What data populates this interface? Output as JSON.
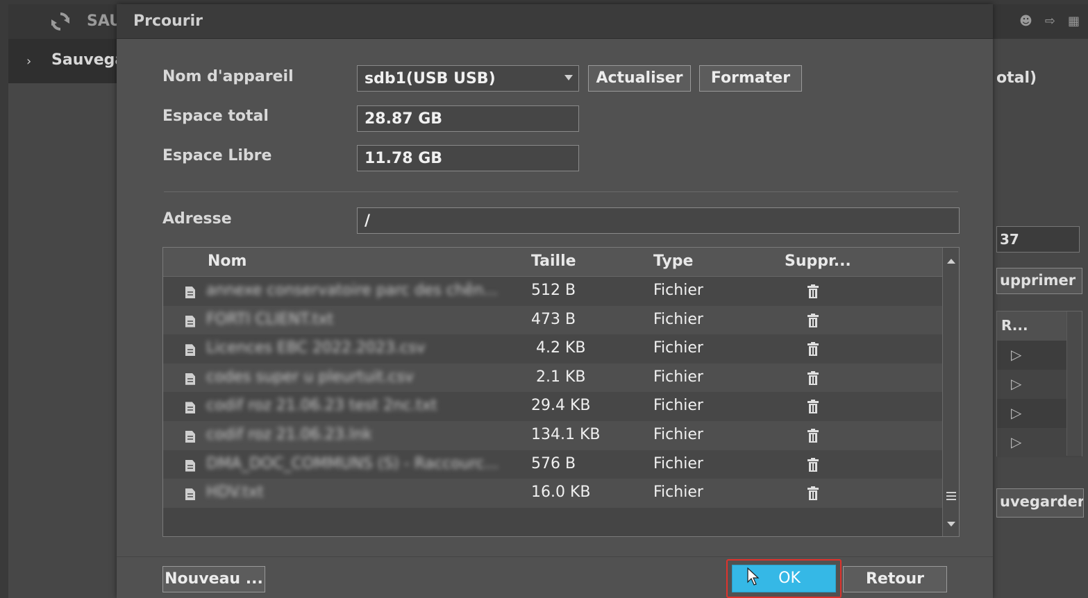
{
  "background": {
    "app_title": "SAU",
    "sidebar_item": "Sauvega",
    "right_label": "otal)",
    "right_field_value": "37",
    "right_button": "upprimer",
    "right_table_header": "R...",
    "right_save_button": "uvegarder"
  },
  "dialog": {
    "title": "Prcourir",
    "device": {
      "label": "Nom d'appareil",
      "value": "sdb1(USB USB)"
    },
    "buttons": {
      "refresh": "Actualiser",
      "format": "Formater",
      "new": "Nouveau ...",
      "ok": "OK",
      "back": "Retour"
    },
    "total_space": {
      "label": "Espace total",
      "value": "28.87 GB"
    },
    "free_space": {
      "label": "Espace Libre",
      "value": "11.78 GB"
    },
    "address": {
      "label": "Adresse",
      "value": "/"
    },
    "table": {
      "columns": [
        "Nom",
        "Taille",
        "Type",
        "Suppr..."
      ],
      "rows": [
        {
          "name": "annexe conservatoire parc des chên...",
          "size": "512 B",
          "type": "Fichier"
        },
        {
          "name": "FORTI CLIENT.txt",
          "size": "473 B",
          "type": "Fichier"
        },
        {
          "name": "Licences EBC 2022.2023.csv",
          "size": " 4.2 KB",
          "type": "Fichier"
        },
        {
          "name": "codes super u pleurtuit.csv",
          "size": " 2.1 KB",
          "type": "Fichier"
        },
        {
          "name": "codif roz 21.06.23 test 2nc.txt",
          "size": "29.4 KB",
          "type": "Fichier"
        },
        {
          "name": "codif roz 21.06.23.lnk",
          "size": "134.1 KB",
          "type": "Fichier"
        },
        {
          "name": "DMA_DOC_COMMUNS (S) - Raccourc...",
          "size": "576 B",
          "type": "Fichier"
        },
        {
          "name": "HDV.txt",
          "size": "16.0 KB",
          "type": "Fichier"
        }
      ]
    }
  },
  "colors": {
    "ok_button": "#35b8e6",
    "highlight": "#e0322c"
  }
}
